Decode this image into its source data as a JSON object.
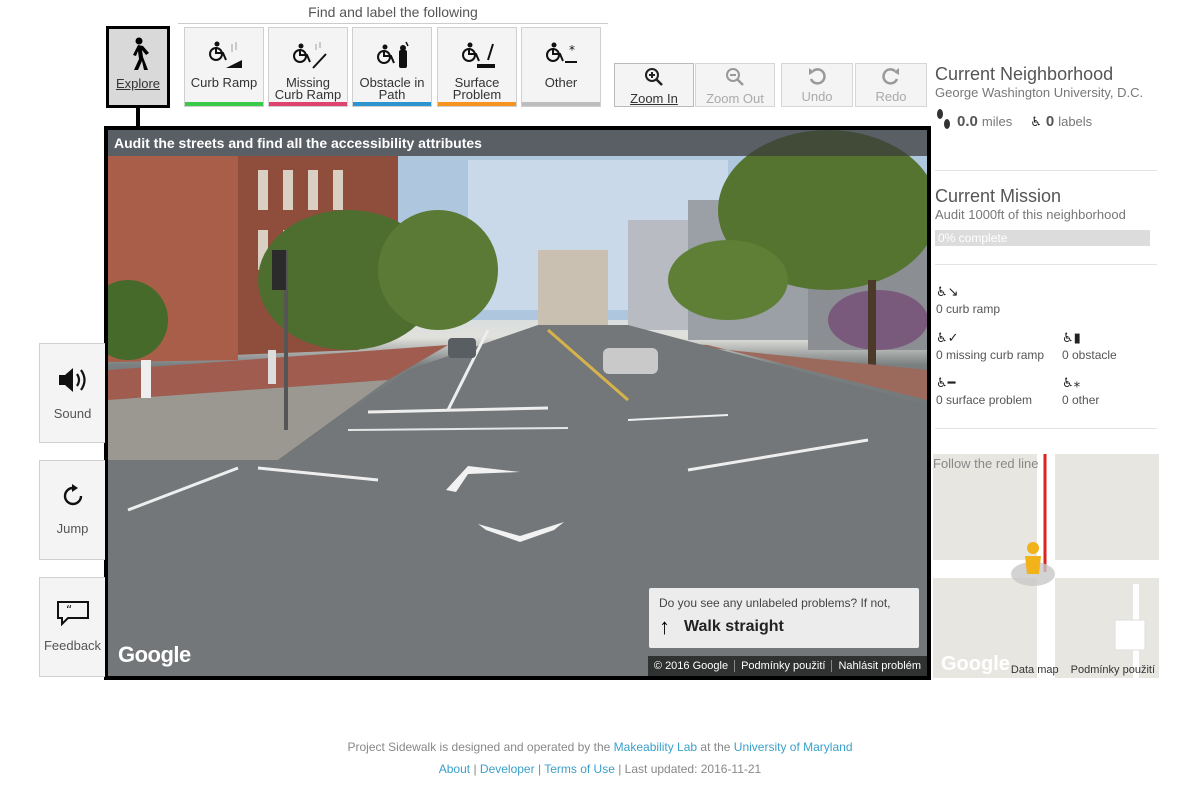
{
  "toolbar": {
    "find_title": "Find and label the following",
    "tools": [
      {
        "label_lines": [
          "Explore"
        ],
        "accent": "#000000",
        "icon": "pedestrian-icon"
      },
      {
        "label_lines": [
          "Curb Ramp"
        ],
        "accent": "#3bc94b",
        "icon": "curb-ramp-icon"
      },
      {
        "label_lines": [
          "Missing",
          "Curb Ramp"
        ],
        "accent": "#e0436e",
        "icon": "missing-curb-ramp-icon"
      },
      {
        "label_lines": [
          "Obstacle in",
          "Path"
        ],
        "accent": "#2c95cf",
        "icon": "obstacle-icon"
      },
      {
        "label_lines": [
          "Surface",
          "Problem"
        ],
        "accent": "#f5941e",
        "icon": "surface-problem-icon"
      },
      {
        "label_lines": [
          "Other"
        ],
        "accent": "#bdbdbd",
        "icon": "other-icon"
      }
    ],
    "nav": {
      "zoom_in": "Zoom In",
      "zoom_out": "Zoom Out",
      "undo": "Undo",
      "redo": "Redo"
    }
  },
  "pano": {
    "header": "Audit the streets and find all the accessibility attributes",
    "google": "Google",
    "walk_prompt": "Do you see any unlabeled problems? If not,",
    "walk_label": "Walk straight",
    "footer": [
      "© 2016 Google",
      "Podmínky použití",
      "Nahlásit problém"
    ]
  },
  "side": {
    "sound": "Sound",
    "jump": "Jump",
    "feedback": "Feedback"
  },
  "neighborhood": {
    "title": "Current Neighborhood",
    "name": "George Washington University, D.C.",
    "miles_value": "0.0",
    "miles_unit": "miles",
    "labels_value": "0",
    "labels_unit": "labels"
  },
  "mission": {
    "title": "Current Mission",
    "description": "Audit 1000ft of this neighborhood",
    "progress_text": "0% complete",
    "progress_fraction": 0.0
  },
  "label_counts": {
    "curb_ramp": "0 curb ramp",
    "missing_curb_ramp": "0 missing curb ramp",
    "obstacle": "0 obstacle",
    "surface_problem": "0 surface problem",
    "other": "0 other"
  },
  "minimap": {
    "title": "Follow the red line",
    "google": "Google",
    "footer": [
      "Data map",
      "Podmínky použití"
    ]
  },
  "footer": {
    "line1_prefix": "Project Sidewalk is designed and operated by the",
    "makeability": "Makeability Lab",
    "line1_mid": "at the",
    "umd": "University of Maryland",
    "about": "About",
    "developer": "Developer",
    "terms": "Terms of Use",
    "updated": "Last updated: 2016-11-21"
  }
}
